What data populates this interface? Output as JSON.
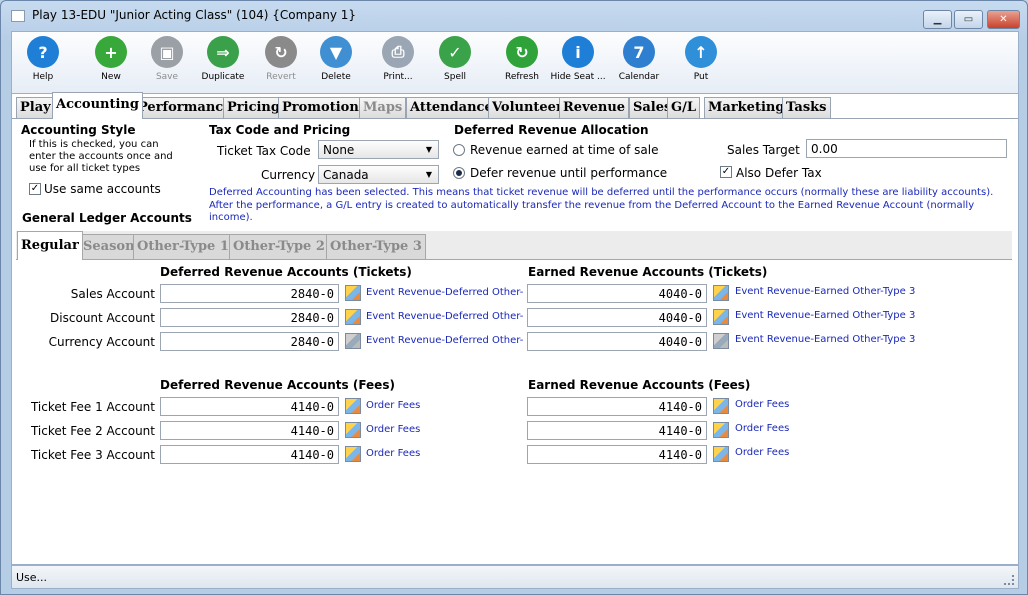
{
  "window": {
    "title": "Play 13-EDU \"Junior Acting Class\" (104) {Company 1}"
  },
  "toolbar": [
    {
      "label": "Help",
      "icon": "help-icon",
      "color": "#1f7fd6",
      "glyph": "?",
      "enabled": true
    },
    {
      "label": "New",
      "icon": "new-document-icon",
      "color": "#39a83a",
      "glyph": "+",
      "enabled": true
    },
    {
      "label": "Save",
      "icon": "save-icon",
      "color": "#9aa0a6",
      "glyph": "▣",
      "enabled": false
    },
    {
      "label": "Duplicate",
      "icon": "duplicate-icon",
      "color": "#3aa04a",
      "glyph": "⇒",
      "enabled": true
    },
    {
      "label": "Revert",
      "icon": "revert-icon",
      "color": "#8a8a8a",
      "glyph": "↻",
      "enabled": false
    },
    {
      "label": "Delete",
      "icon": "delete-icon",
      "color": "#3f8fd2",
      "glyph": "▼",
      "enabled": true
    },
    {
      "label": "Print...",
      "icon": "print-icon",
      "color": "#9aa6b4",
      "glyph": "⎙",
      "enabled": true
    },
    {
      "label": "Spell",
      "icon": "spell-check-icon",
      "color": "#3aa34a",
      "glyph": "✓",
      "enabled": true
    },
    {
      "label": "Refresh",
      "icon": "refresh-icon",
      "color": "#2fa33a",
      "glyph": "↻",
      "enabled": true
    },
    {
      "label": "Hide Seat ...",
      "icon": "info-icon",
      "color": "#1f7fd6",
      "glyph": "i",
      "enabled": true
    },
    {
      "label": "Calendar",
      "icon": "calendar-icon",
      "color": "#2f7fd0",
      "glyph": "7",
      "enabled": true
    },
    {
      "label": "Put",
      "icon": "put-icon",
      "color": "#2f8fd8",
      "glyph": "↑",
      "enabled": true
    }
  ],
  "tabs": [
    "Play",
    "Accounting",
    "Performance",
    "Pricing",
    "Promotions",
    "Maps",
    "Attendance",
    "Volunteer",
    "Revenue",
    "Sales",
    "G/L",
    "Marketing",
    "Tasks"
  ],
  "accounting_style": {
    "heading": "Accounting Style",
    "desc1": "If this is checked, you can",
    "desc2": "enter the accounts once and",
    "desc3": "use for all ticket types",
    "use_same_label": "Use same accounts",
    "use_same_checked": true
  },
  "tax": {
    "heading": "Tax Code and Pricing",
    "ticket_tax_label": "Ticket Tax Code",
    "ticket_tax_value": "None",
    "currency_label": "Currency",
    "currency_value": "Canada"
  },
  "deferred": {
    "heading": "Deferred Revenue Allocation",
    "option1": "Revenue earned at time of sale",
    "option2": "Defer revenue until performance",
    "selected": 2,
    "sales_target_label": "Sales Target",
    "sales_target_value": "0.00",
    "also_defer_tax_label": "Also Defer Tax",
    "also_defer_tax_checked": true,
    "note1": "Deferred Accounting has been selected.  This means that ticket revenue will be deferred until the performance occurs (normally these are liability accounts).",
    "note2": "After the performance, a G/L entry is created to automatically transfer the revenue from the Deferred Account to the Earned Revenue Account (normally",
    "note3": "income)."
  },
  "gl_heading": "General Ledger Accounts",
  "subtabs": [
    "Regular",
    "Season",
    "Other-Type 1",
    "Other-Type 2",
    "Other-Type 3"
  ],
  "tickets": {
    "deferred_heading": "Deferred Revenue Accounts (Tickets)",
    "earned_heading": "Earned Revenue Accounts (Tickets)",
    "rows": [
      {
        "label": "Sales Account",
        "def": "2840-0",
        "def_desc": "Event Revenue-Deferred Other-",
        "earn": "4040-0",
        "earn_desc": "Event Revenue-Earned Other-Type 3"
      },
      {
        "label": "Discount Account",
        "def": "2840-0",
        "def_desc": "Event Revenue-Deferred Other-",
        "earn": "4040-0",
        "earn_desc": "Event Revenue-Earned Other-Type 3"
      },
      {
        "label": "Currency Account",
        "def": "2840-0",
        "def_desc": "Event Revenue-Deferred Other-",
        "earn": "4040-0",
        "earn_desc": "Event Revenue-Earned Other-Type 3"
      }
    ]
  },
  "fees": {
    "deferred_heading": "Deferred Revenue Accounts (Fees)",
    "earned_heading": "Earned Revenue Accounts (Fees)",
    "rows": [
      {
        "label": "Ticket Fee 1 Account",
        "def": "4140-0",
        "def_desc": "Order Fees",
        "earn": "4140-0",
        "earn_desc": "Order Fees"
      },
      {
        "label": "Ticket Fee 2 Account",
        "def": "4140-0",
        "def_desc": "Order Fees",
        "earn": "4140-0",
        "earn_desc": "Order Fees"
      },
      {
        "label": "Ticket Fee 3 Account",
        "def": "4140-0",
        "def_desc": "Order Fees",
        "earn": "4140-0",
        "earn_desc": "Order Fees"
      }
    ]
  },
  "status": "Use..."
}
